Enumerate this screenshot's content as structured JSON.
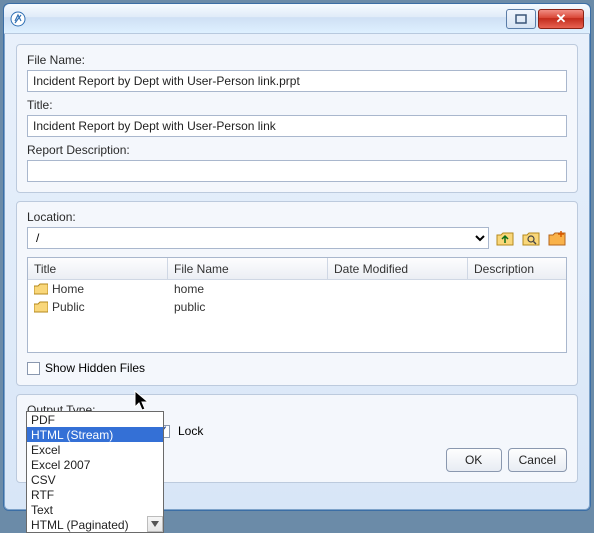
{
  "labels": {
    "filename": "File Name:",
    "title": "Title:",
    "desc": "Report Description:",
    "location": "Location:",
    "output_type": "Output Type:",
    "lock": "Lock",
    "show_hidden": "Show Hidden Files"
  },
  "values": {
    "filename": "Incident Report by Dept with User-Person link.prpt",
    "title": "Incident Report by Dept with User-Person link",
    "desc": "",
    "location": "/",
    "output_selected": "HTML (Stream)"
  },
  "table": {
    "headers": {
      "c1": "Title",
      "c2": "File Name",
      "c3": "Date Modified",
      "c4": "Description"
    },
    "rows": [
      {
        "title": "Home",
        "filename": "home",
        "modified": "",
        "desc": ""
      },
      {
        "title": "Public",
        "filename": "public",
        "modified": "",
        "desc": ""
      }
    ]
  },
  "dropdown": {
    "items": [
      "PDF",
      "HTML (Stream)",
      "Excel",
      "Excel 2007",
      "CSV",
      "RTF",
      "Text",
      "HTML (Paginated)"
    ],
    "selected_index": 1
  },
  "buttons": {
    "ok": "OK",
    "cancel": "Cancel"
  },
  "lock_checked": true,
  "show_hidden_checked": false
}
